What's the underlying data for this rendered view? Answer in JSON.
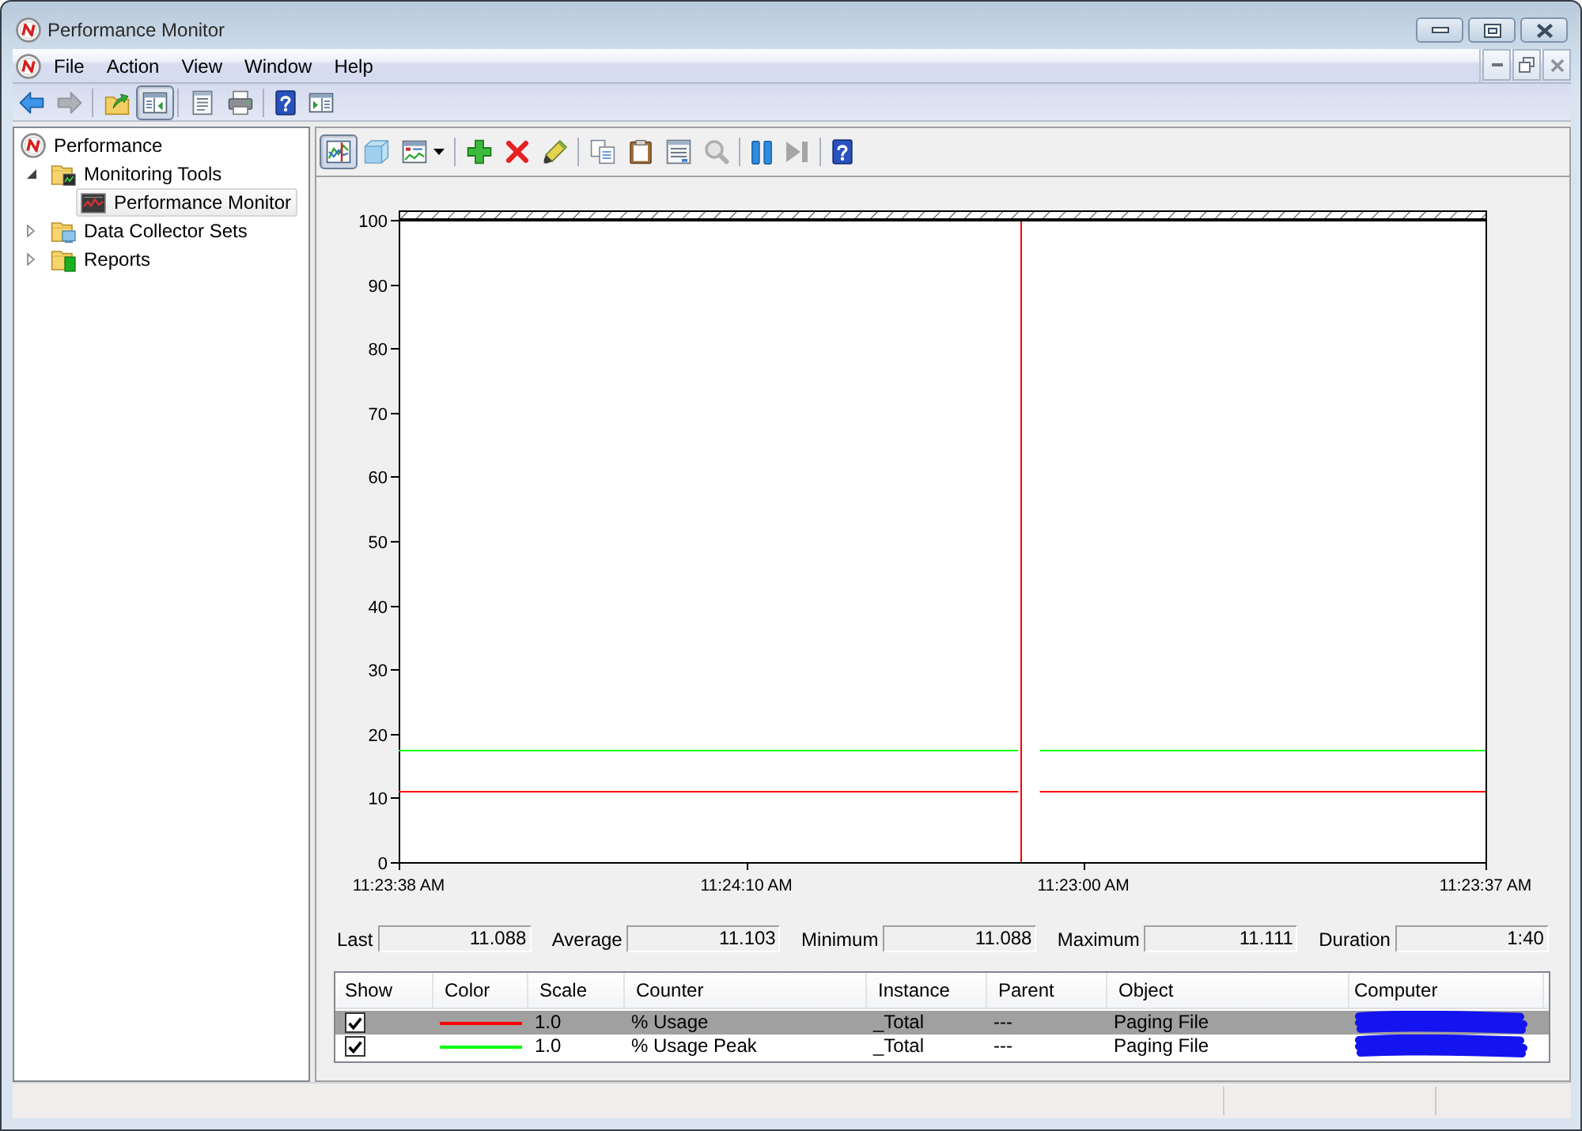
{
  "window": {
    "title": "Performance Monitor"
  },
  "menu": [
    "File",
    "Action",
    "View",
    "Window",
    "Help"
  ],
  "toolbar": {
    "groups": [
      [
        {
          "kind": "back",
          "pressed": false,
          "disabled": false
        },
        {
          "kind": "forward",
          "pressed": false,
          "disabled": true
        }
      ],
      [
        {
          "kind": "up",
          "pressed": false,
          "disabled": false
        },
        {
          "kind": "tree",
          "pressed": true,
          "disabled": false
        }
      ],
      [
        {
          "kind": "properties",
          "pressed": false,
          "disabled": false
        },
        {
          "kind": "print",
          "pressed": false,
          "disabled": false
        }
      ],
      [
        {
          "kind": "help",
          "pressed": false,
          "disabled": false
        },
        {
          "kind": "actions",
          "pressed": false,
          "disabled": false
        }
      ]
    ]
  },
  "tree": {
    "label": "Performance",
    "kind": "performance",
    "selected": false,
    "children": [
      {
        "label": "Monitoring Tools",
        "kind": "tools",
        "expanded": true,
        "selected": false,
        "children": [
          {
            "label": "Performance Monitor",
            "kind": "monitor",
            "selected": true
          }
        ]
      },
      {
        "label": "Data Collector Sets",
        "kind": "collectors",
        "expanded": false,
        "selected": false
      },
      {
        "label": "Reports",
        "kind": "reports",
        "expanded": false,
        "selected": false
      }
    ]
  },
  "chart_toolbar": {
    "groups": [
      [
        {
          "kind": "live",
          "pressed": true,
          "disabled": false
        },
        {
          "kind": "log",
          "pressed": false,
          "disabled": false
        },
        {
          "kind": "graphtype",
          "pressed": false,
          "disabled": false
        }
      ],
      [
        {
          "kind": "add",
          "pressed": false,
          "disabled": false
        },
        {
          "kind": "delete",
          "pressed": false,
          "disabled": false
        },
        {
          "kind": "highlight",
          "pressed": false,
          "disabled": false
        }
      ],
      [
        {
          "kind": "copy",
          "pressed": false,
          "disabled": false
        },
        {
          "kind": "paste",
          "pressed": false,
          "disabled": false
        },
        {
          "kind": "properties",
          "pressed": false,
          "disabled": false
        },
        {
          "kind": "zoom",
          "pressed": false,
          "disabled": true
        }
      ],
      [
        {
          "kind": "freeze",
          "pressed": false,
          "disabled": false
        },
        {
          "kind": "update",
          "pressed": false,
          "disabled": true
        }
      ],
      [
        {
          "kind": "help",
          "pressed": false,
          "disabled": false
        }
      ]
    ]
  },
  "graph": {
    "chart_data": {
      "type": "line",
      "categories": [
        "11:23:38 AM",
        null,
        null,
        null,
        null,
        null,
        null,
        null,
        null,
        null,
        null,
        null,
        null,
        null,
        null,
        null,
        null,
        null,
        null,
        null,
        null,
        null,
        null,
        null,
        null,
        null,
        null,
        null,
        null,
        null,
        null,
        null,
        "11:24:10 AM",
        null,
        null,
        null,
        null,
        null,
        null,
        null,
        null,
        null,
        null,
        null,
        null,
        null,
        null,
        null,
        null,
        null,
        null,
        null,
        null,
        null,
        null,
        null,
        null,
        null,
        null,
        null,
        null,
        null,
        null,
        "11:23:00 AM",
        null,
        null,
        null,
        null,
        null,
        null,
        null,
        null,
        null,
        null,
        null,
        null,
        null,
        null,
        null,
        null,
        null,
        null,
        null,
        null,
        null,
        null,
        null,
        null,
        null,
        null,
        null,
        null,
        null,
        null,
        null,
        null,
        null,
        null,
        null,
        null,
        "11:23:37 AM"
      ],
      "series": [
        {
          "color": "#ff0000",
          "values": [
            11,
            11,
            11,
            11,
            11,
            11,
            11,
            11,
            11,
            11,
            11,
            11,
            11,
            11,
            11,
            11,
            11,
            11,
            11,
            11,
            11,
            11,
            11,
            11,
            11,
            11,
            11,
            11,
            11,
            11,
            11,
            11,
            11,
            11,
            11,
            11,
            11,
            11,
            11,
            11,
            11,
            11,
            11,
            11,
            11,
            11,
            11,
            11,
            11,
            11,
            11,
            11,
            11,
            11,
            11,
            11,
            11,
            11,
            null,
            11,
            11,
            11,
            11,
            11,
            11,
            11,
            11,
            11,
            11,
            11,
            11,
            11,
            11,
            11,
            11,
            11,
            11,
            11,
            11,
            11,
            11,
            11,
            11,
            11,
            11,
            11,
            11,
            11,
            11,
            11,
            11,
            11,
            11,
            11,
            11,
            11,
            11,
            11,
            11,
            11,
            11
          ]
        },
        {
          "color": "#00ff00",
          "values": [
            17.5,
            17.5,
            17.5,
            17.5,
            17.5,
            17.5,
            17.5,
            17.5,
            17.5,
            17.5,
            17.5,
            17.5,
            17.5,
            17.5,
            17.5,
            17.5,
            17.5,
            17.5,
            17.5,
            17.5,
            17.5,
            17.5,
            17.5,
            17.5,
            17.5,
            17.5,
            17.5,
            17.5,
            17.5,
            17.5,
            17.5,
            17.5,
            17.5,
            17.5,
            17.5,
            17.5,
            17.5,
            17.5,
            17.5,
            17.5,
            17.5,
            17.5,
            17.5,
            17.5,
            17.5,
            17.5,
            17.5,
            17.5,
            17.5,
            17.5,
            17.5,
            17.5,
            17.5,
            17.5,
            17.5,
            17.5,
            17.5,
            17.5,
            null,
            17.5,
            17.5,
            17.5,
            17.5,
            17.5,
            17.5,
            17.5,
            17.5,
            17.5,
            17.5,
            17.5,
            17.5,
            17.5,
            17.5,
            17.5,
            17.5,
            17.5,
            17.5,
            17.5,
            17.5,
            17.5,
            17.5,
            17.5,
            17.5,
            17.5,
            17.5,
            17.5,
            17.5,
            17.5,
            17.5,
            17.5,
            17.5,
            17.5,
            17.5,
            17.5,
            17.5,
            17.5,
            17.5,
            17.5,
            17.5,
            17.5,
            17.5
          ]
        }
      ],
      "ylim": [
        0,
        100
      ],
      "yticks": [
        0,
        10,
        20,
        30,
        40,
        50,
        60,
        70,
        80,
        90,
        100
      ]
    }
  },
  "stats": [
    {
      "label": "Last",
      "value": "11.088"
    },
    {
      "label": "Average",
      "value": "11.103"
    },
    {
      "label": "Minimum",
      "value": "11.088"
    },
    {
      "label": "Maximum",
      "value": "11.111"
    },
    {
      "label": "Duration",
      "value": "1:40"
    }
  ],
  "legend": {
    "columns": [
      "Show",
      "Color",
      "Scale",
      "Counter",
      "Instance",
      "Parent",
      "Object",
      "Computer"
    ],
    "rows": [
      {
        "selected": true,
        "show": true,
        "color": "#ff0000",
        "scale": "1.0",
        "counter": "% Usage",
        "instance": "_Total",
        "parent": "---",
        "object": "Paging File",
        "computer_hidden": true
      },
      {
        "selected": false,
        "show": true,
        "color": "#00ff00",
        "scale": "1.0",
        "counter": "% Usage Peak",
        "instance": "_Total",
        "parent": "---",
        "object": "Paging File",
        "computer_hidden": true
      }
    ]
  }
}
